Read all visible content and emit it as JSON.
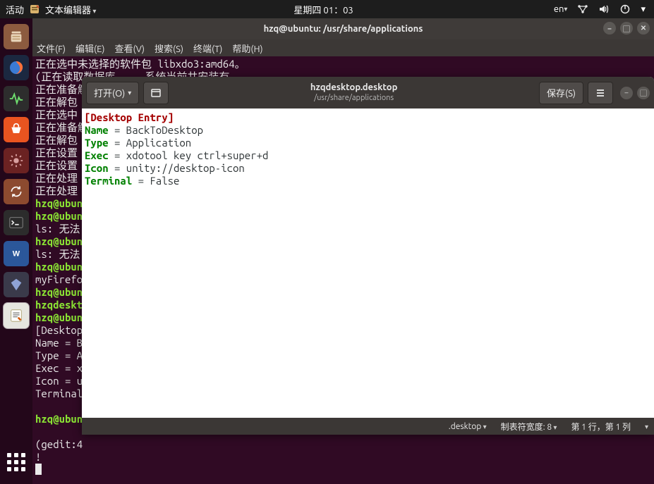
{
  "top_panel": {
    "activities": "活动",
    "app_label": "文本编辑器",
    "clock": "星期四 01：03",
    "lang": "en"
  },
  "terminal": {
    "title": "hzq@ubuntu: /usr/share/applications",
    "menus": [
      "文件(F)",
      "编辑(E)",
      "查看(V)",
      "搜索(S)",
      "终端(T)",
      "帮助(H)"
    ],
    "lines_pre": [
      "正在选中未选择的软件包 libxdo3:amd64。",
      "(正在读取数据库 ... 系统当前共安装有",
      "正在准备解包",
      "正在解包",
      "正在选中",
      "正在准备解",
      "正在解包",
      "正在设置",
      "正在设置",
      "正在处理",
      "正在处理"
    ],
    "prompt_lines": [
      "hzq@ubun",
      "hzq@ubun",
      "ls: 无法",
      "hzq@ubun",
      "ls: 无法",
      "hzq@ubun",
      "myFirefo",
      "hzq@ubun",
      "hzqdeskt",
      "hzq@ubun"
    ],
    "tail": [
      "[Desktop",
      "Name = B",
      "Type = A",
      "Exec = x",
      "Icon = u",
      "Terminal"
    ],
    "post_prompt": "hzq@ubun",
    "post2": "(gedit:4",
    "post3": "!"
  },
  "gedit": {
    "open_label": "打开(O)",
    "save_label": "保存(S)",
    "title_main": "hzqdesktop.desktop",
    "title_sub": "/usr/share/applications",
    "content": {
      "section": "[Desktop Entry]",
      "kv": [
        {
          "k": "Name",
          "v": " = BackToDesktop"
        },
        {
          "k": "Type",
          "v": " = Application"
        },
        {
          "k": "Exec",
          "v": " = xdotool key ctrl+super+d"
        },
        {
          "k": "Icon",
          "v": " = unity://desktop-icon"
        },
        {
          "k": "Terminal",
          "v": " = False"
        }
      ]
    },
    "status": {
      "language": ".desktop",
      "tabwidth_label": "制表符宽度: 8",
      "cursor_pos": "第 1 行，第 1 列"
    }
  },
  "dock": {
    "icons": [
      "files",
      "firefox",
      "monitor",
      "software",
      "settings",
      "update",
      "terminal",
      "word",
      "diamond",
      "gedit"
    ]
  }
}
